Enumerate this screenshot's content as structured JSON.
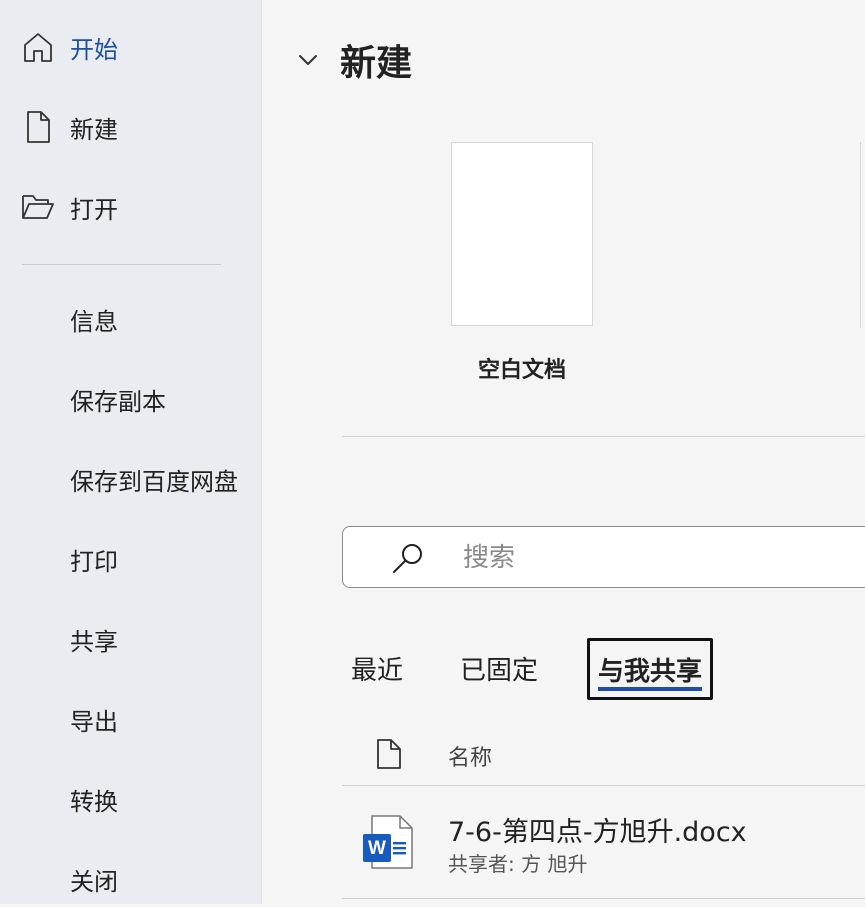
{
  "sidebar": {
    "items": [
      {
        "label": "开始",
        "icon": "home-icon",
        "active": true
      },
      {
        "label": "新建",
        "icon": "new-document-icon"
      },
      {
        "label": "打开",
        "icon": "open-folder-icon"
      },
      {
        "label": "信息"
      },
      {
        "label": "保存副本"
      },
      {
        "label": "保存到百度网盘"
      },
      {
        "label": "打印"
      },
      {
        "label": "共享"
      },
      {
        "label": "导出"
      },
      {
        "label": "转换"
      },
      {
        "label": "关闭"
      }
    ]
  },
  "main": {
    "section_title": "新建",
    "templates": [
      {
        "label": "空白文档"
      }
    ],
    "search": {
      "placeholder": "搜索",
      "value": ""
    },
    "tabs": [
      {
        "label": "最近"
      },
      {
        "label": "已固定"
      },
      {
        "label": "与我共享",
        "selected": true
      }
    ],
    "table": {
      "header_name": "名称",
      "rows": [
        {
          "name": "7-6-第四点-方旭升.docx",
          "shared_by": "共享者: 方 旭升",
          "icon": "word-document-icon"
        }
      ]
    }
  },
  "colors": {
    "accent": "#1e4fa3",
    "sidebar_bg": "#e9edf1",
    "main_bg": "#f5f5f5",
    "word_blue": "#185abd"
  }
}
